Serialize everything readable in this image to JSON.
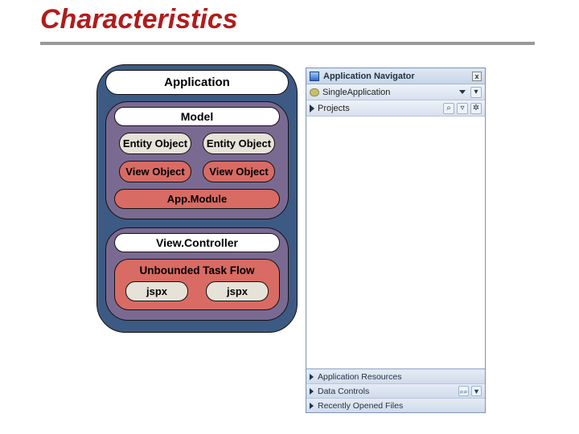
{
  "page": {
    "title": "Characteristics"
  },
  "diagram": {
    "application_label": "Application",
    "model_label": "Model",
    "entity_object_label": "Entity Object",
    "view_object_label": "View Object",
    "app_module_label": "App.Module",
    "view_controller_label": "View.Controller",
    "taskflow_label": "Unbounded Task Flow",
    "jspx_label": "jspx"
  },
  "navigator": {
    "title": "Application Navigator",
    "project_name": "SingleApplication",
    "folder_label": "Projects",
    "sections": {
      "app_resources": "Application Resources",
      "data_controls": "Data Controls",
      "recent_files": "Recently Opened Files"
    },
    "icons": {
      "close": "x",
      "search": "⌕",
      "filter": "▿",
      "gear": "✲",
      "binoculars": "⌕⌕",
      "funnel": "▼"
    }
  }
}
